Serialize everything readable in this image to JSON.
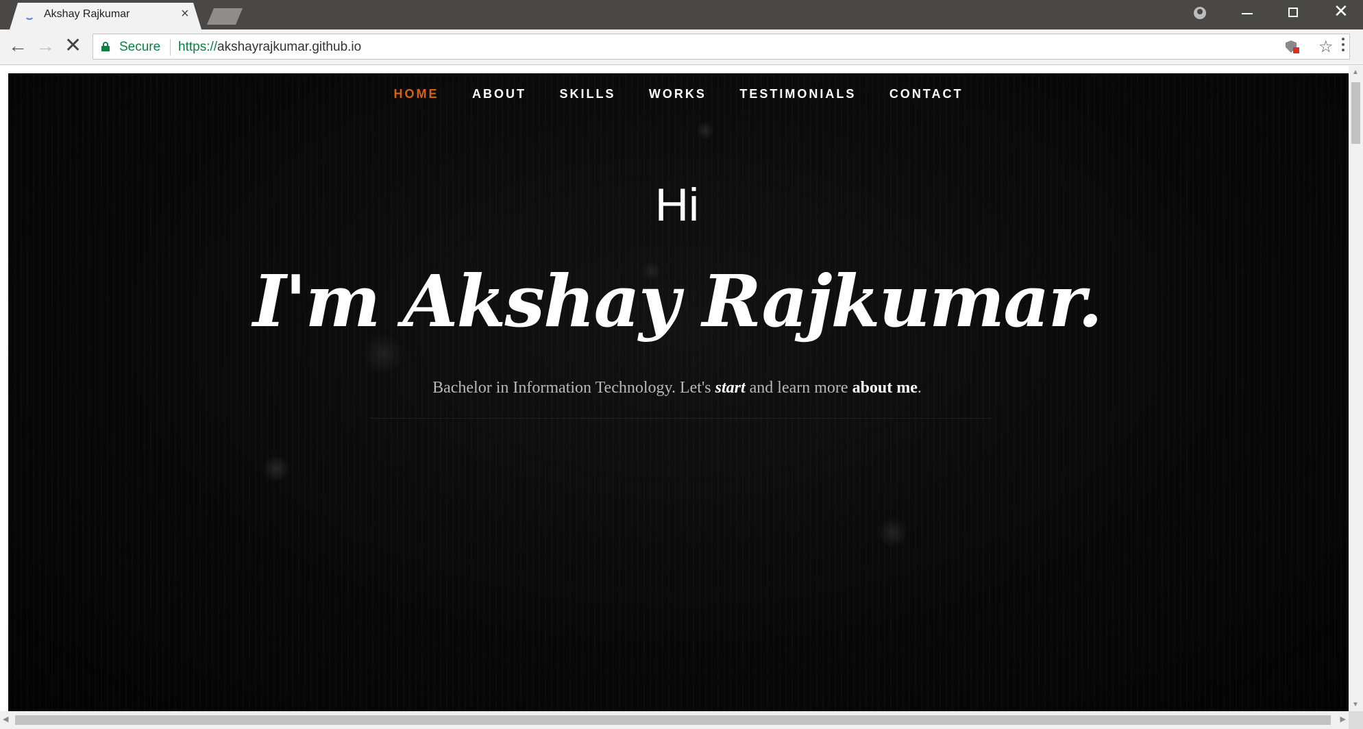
{
  "browser": {
    "tab_title": "Akshay Rajkumar",
    "tab_close": "×",
    "secure_label": "Secure",
    "url_scheme": "https://",
    "url_host": "akshayrajkumar.github.io",
    "icons": {
      "back": "arrow-left-icon",
      "forward": "arrow-right-icon",
      "stop": "close-icon",
      "lock": "lock-icon",
      "shield": "shield-icon",
      "star": "star-icon",
      "menu": "more-vert-icon",
      "profile": "profile-icon",
      "minimize": "minimize-icon",
      "restore": "restore-icon",
      "close_window": "close-icon"
    }
  },
  "nav": {
    "items": [
      {
        "label": "HOME",
        "active": true
      },
      {
        "label": "ABOUT",
        "active": false
      },
      {
        "label": "SKILLS",
        "active": false
      },
      {
        "label": "WORKS",
        "active": false
      },
      {
        "label": "TESTIMONIALS",
        "active": false
      },
      {
        "label": "CONTACT",
        "active": false
      }
    ]
  },
  "hero": {
    "greeting": "Hi",
    "headline": "I'm Akshay Rajkumar.",
    "sub_prefix": "Bachelor in Information Technology. Let's ",
    "sub_em": "start",
    "sub_middle": " and learn more ",
    "sub_link": "about me",
    "sub_suffix": "."
  },
  "colors": {
    "accent": "#d8610f",
    "secure_green": "#0b8043",
    "chrome_dark": "#4a4846"
  }
}
